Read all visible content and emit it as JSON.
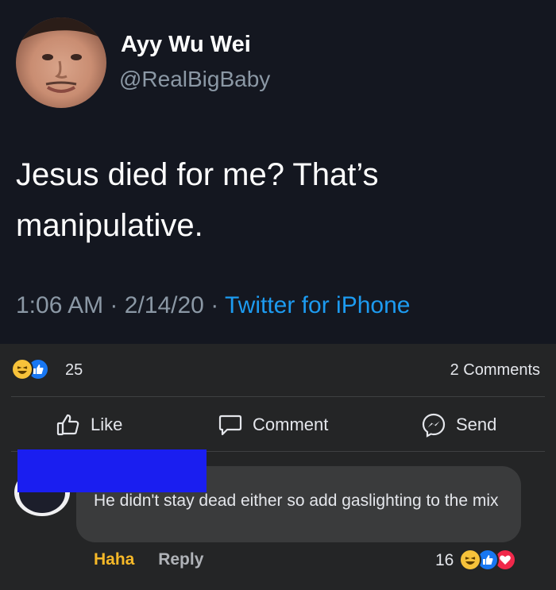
{
  "tweet": {
    "author_name": "Ayy Wu Wei",
    "author_handle": "@RealBigBaby",
    "text": "Jesus died for me? That’s manipulative.",
    "time": "1:06 AM",
    "date": "2/14/20",
    "separator": "·",
    "source": "Twitter for iPhone"
  },
  "post": {
    "reaction_count": "25",
    "comments_count": "2 Comments",
    "reactions": [
      "haha-icon",
      "like-icon"
    ],
    "actions": {
      "like_label": "Like",
      "comment_label": "Comment",
      "send_label": "Send"
    }
  },
  "comment": {
    "text": "He didn't stay dead either so add gaslighting to the mix",
    "haha_label": "Haha",
    "reply_label": "Reply",
    "reaction_count": "16",
    "reactions": [
      "haha-icon",
      "like-icon",
      "love-icon"
    ]
  },
  "colors": {
    "tweet_background": "#141720",
    "post_background": "#242526",
    "link_blue": "#1d9bf0",
    "haha_yellow": "#f7b928",
    "redaction_blue": "#1a1ef0"
  }
}
